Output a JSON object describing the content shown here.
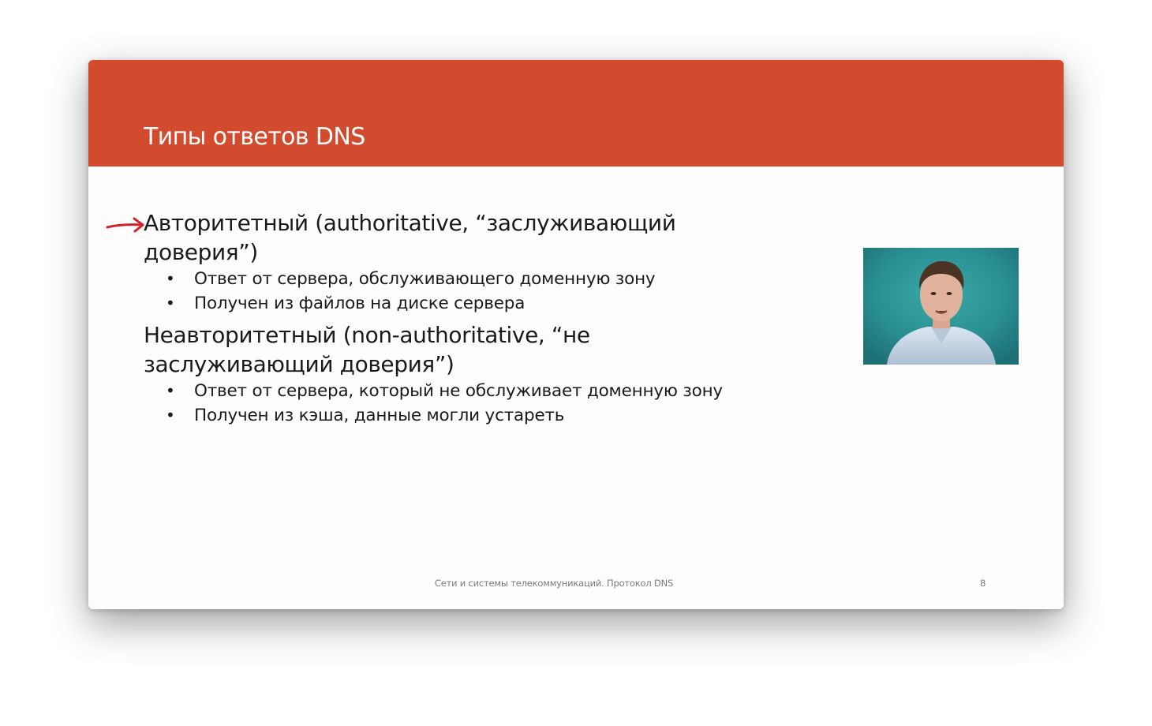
{
  "slide": {
    "title": "Типы ответов DNS",
    "colors": {
      "header": "#d34b2e",
      "pointer": "#d2232a"
    },
    "pointer_icon": "red-arrow-pointer-icon",
    "items": [
      {
        "heading": "Авторитетный (authoritative, “заслуживающий доверия”)",
        "bullets": [
          "Ответ от сервера, обслуживающего доменную зону",
          "Получен из файлов на диске сервера"
        ]
      },
      {
        "heading": "Неавторитетный (non-authoritative, “не заслуживающий доверия”)",
        "bullets": [
          "Ответ от сервера, который не обслуживает доменную зону",
          "Получен из кэша, данные могли устареть"
        ]
      }
    ],
    "bullet_glyph": "•",
    "footer": "Сети и системы телекоммуникаций. Протокол DNS",
    "page_number": "8",
    "video_icon": "presenter-video-icon"
  }
}
